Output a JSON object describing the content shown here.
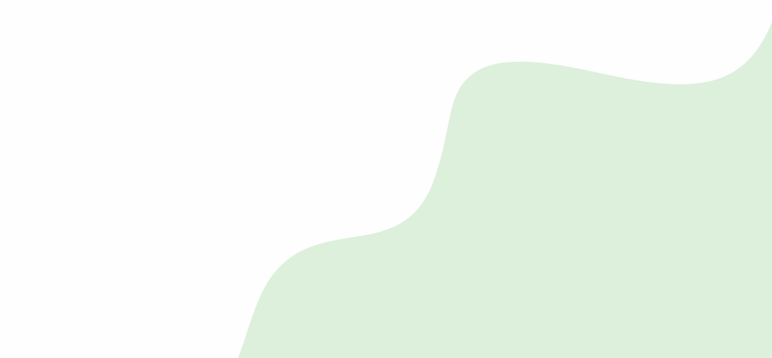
{
  "page": {
    "background_color": "#fefefe"
  },
  "decoration": {
    "shape": "wave-blob",
    "fill_color": "#dcf0dc"
  }
}
